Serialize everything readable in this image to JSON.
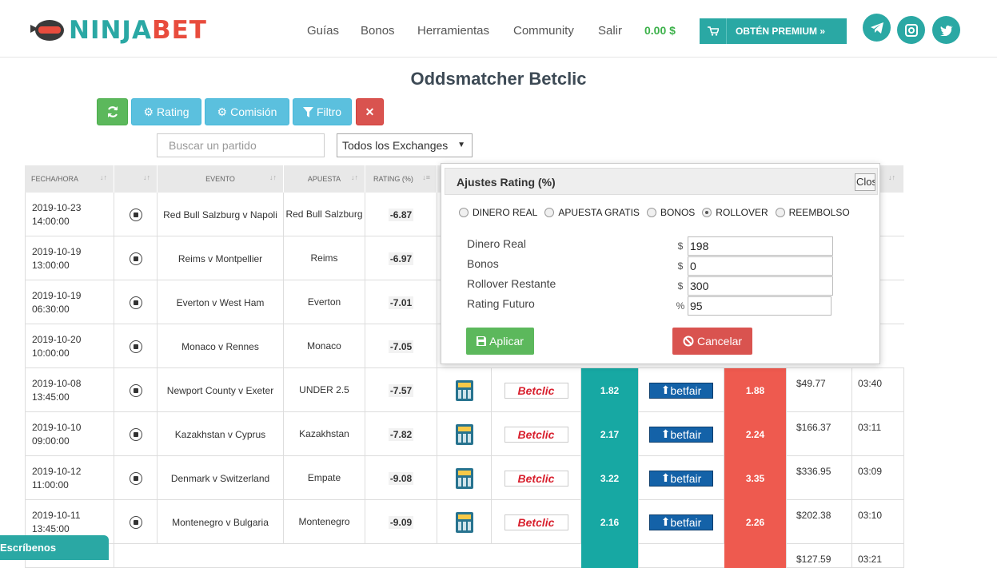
{
  "brand": {
    "part1": "NINJA",
    "part2": "BET"
  },
  "nav": [
    "Guías",
    "Bonos",
    "Herramientas",
    "Community",
    "Salir"
  ],
  "balance": "0.00 $",
  "premium_label": "OBTÉN PREMIUM »",
  "page_title": "Oddsmatcher Betclic",
  "toolbar": {
    "rating": "Rating",
    "commission": "Comisión",
    "filter": "Filtro"
  },
  "search": {
    "placeholder": "Buscar un partido"
  },
  "exchanges_select": "Todos los Exchanges",
  "table": {
    "headers": [
      "FECHA/HORA",
      "",
      "EVENTO",
      "APUESTA",
      "RATING (%)"
    ],
    "rows": [
      {
        "date": "2019-10-23",
        "time": "14:00:00",
        "event": "Red Bull Salzburg v Napoli",
        "bet": "Red Bull Salzburg",
        "rating": "-6.87",
        "back": "",
        "lay": "",
        "amount": "",
        "clock": ""
      },
      {
        "date": "2019-10-19",
        "time": "13:00:00",
        "event": "Reims v Montpellier",
        "bet": "Reims",
        "rating": "-6.97",
        "back": "",
        "lay": "",
        "amount": "",
        "clock": ""
      },
      {
        "date": "2019-10-19",
        "time": "06:30:00",
        "event": "Everton v West Ham",
        "bet": "Everton",
        "rating": "-7.01",
        "back": "",
        "lay": "",
        "amount": "",
        "clock": ""
      },
      {
        "date": "2019-10-20",
        "time": "10:00:00",
        "event": "Monaco v Rennes",
        "bet": "Monaco",
        "rating": "-7.05",
        "back": "",
        "lay": "",
        "amount": "",
        "clock": ""
      },
      {
        "date": "2019-10-08",
        "time": "13:45:00",
        "event": "Newport County v Exeter",
        "bet": "UNDER 2.5",
        "rating": "-7.57",
        "back": "1.82",
        "lay": "1.88",
        "amount": "$49.77",
        "clock": "03:40"
      },
      {
        "date": "2019-10-10",
        "time": "09:00:00",
        "event": "Kazakhstan v Cyprus",
        "bet": "Kazakhstan",
        "rating": "-7.82",
        "back": "2.17",
        "lay": "2.24",
        "amount": "$166.37",
        "clock": "03:11"
      },
      {
        "date": "2019-10-12",
        "time": "11:00:00",
        "event": "Denmark v Switzerland",
        "bet": "Empate",
        "rating": "-9.08",
        "back": "3.22",
        "lay": "3.35",
        "amount": "$336.95",
        "clock": "03:09"
      },
      {
        "date": "2019-10-11",
        "time": "13:45:00",
        "event": "Montenegro v Bulgaria",
        "bet": "Montenegro",
        "rating": "-9.09",
        "back": "2.16",
        "lay": "2.26",
        "amount": "$202.38",
        "clock": "03:10"
      }
    ],
    "partial_row": {
      "amount": "$127.59",
      "clock": "03:21"
    },
    "bookmaker": "Betclic",
    "exchange": "betfair"
  },
  "modal": {
    "title": "Ajustes Rating (%)",
    "close": "Close",
    "options": [
      "DINERO REAL",
      "APUESTA GRATIS",
      "BONOS",
      "ROLLOVER",
      "REEMBOLSO"
    ],
    "selected_option": "ROLLOVER",
    "fields": [
      {
        "label": "Dinero Real",
        "prefix": "$",
        "value": "198"
      },
      {
        "label": "Bonos",
        "prefix": "$",
        "value": "0"
      },
      {
        "label": "Rollover Restante",
        "prefix": "$",
        "value": "300"
      },
      {
        "label": "Rating Futuro",
        "prefix": "%",
        "value": "95"
      }
    ],
    "apply": "Aplicar",
    "cancel": "Cancelar"
  },
  "chat": "Escríbenos",
  "colors": {
    "brand_teal": "#2aa8a4",
    "brand_red": "#e84c3d",
    "back_cell": "#17a8a3",
    "lay_cell": "#ee5a4f"
  }
}
